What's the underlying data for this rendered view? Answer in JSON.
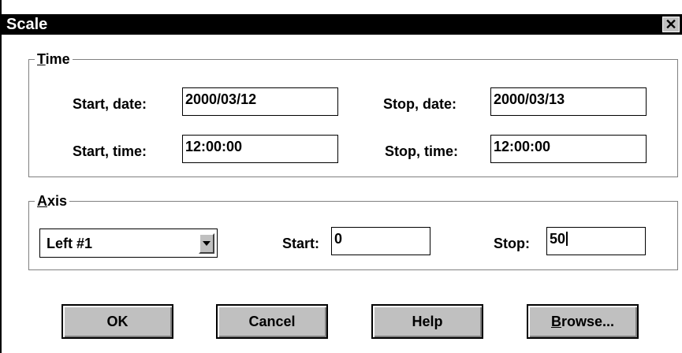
{
  "window": {
    "title": "Scale",
    "close_glyph": "✕"
  },
  "time_group": {
    "label_hotkey": "T",
    "label_rest": "ime",
    "start_date_label": "Start, date:",
    "start_date_value": "2000/03/12",
    "stop_date_label": "Stop, date:",
    "stop_date_value": "2000/03/13",
    "start_time_label": "Start, time:",
    "start_time_value": "12:00:00",
    "stop_time_label": "Stop, time:",
    "stop_time_value": "12:00:00"
  },
  "axis_group": {
    "label_hotkey": "A",
    "label_rest": "xis",
    "axis_select_value": "Left #1",
    "start_label": "Start:",
    "start_value": "0",
    "stop_label": "Stop:",
    "stop_value": "50"
  },
  "buttons": {
    "ok": "OK",
    "cancel": "Cancel",
    "help": "Help",
    "browse_hotkey": "B",
    "browse_rest": "rowse..."
  },
  "colors": {
    "titlebar": "#000000",
    "button_face": "#c0c0c0",
    "dialog_bg": "#ffffff"
  },
  "icons": {
    "close": "close-icon",
    "dropdown": "chevron-down-icon"
  }
}
